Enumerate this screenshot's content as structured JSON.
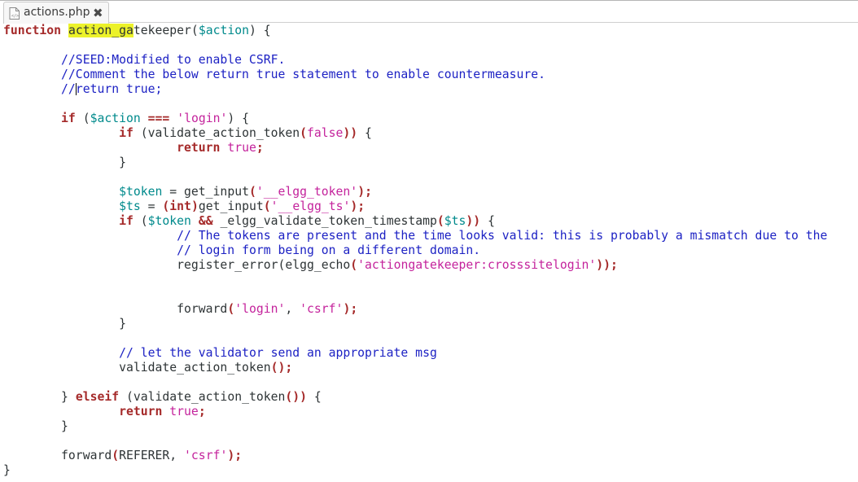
{
  "tab": {
    "filename": "actions.php",
    "file_icon": "document-icon",
    "close_icon": "close-x-icon"
  },
  "search": {
    "highlight": "action_ga"
  },
  "code": {
    "l1_kw": "function",
    "l1_hl": "action_ga",
    "l1_rest": "tekeeper(",
    "l1_var": "$action",
    "l1_end": ") {",
    "l3": "//SEED:Modified to enable CSRF.",
    "l4": "//Comment the below return true statement to enable countermeasure.",
    "l5_a": "//",
    "l5_b": "return true;",
    "l7_kw": "if",
    "l7_a": " (",
    "l7_var": "$action",
    "l7_b": " ",
    "l7_op": "===",
    "l7_c": " ",
    "l7_str": "'login'",
    "l7_d": ") {",
    "l8_kw": "if",
    "l8_a": " (validate_action_token",
    "l8_p1": "(",
    "l8_false": "false",
    "l8_p2": "))",
    "l8_b": " {",
    "l9_kw": "return",
    "l9_sp": " ",
    "l9_true": "true",
    "l9_semi": ";",
    "l10": "}",
    "l12_var": "$token",
    "l12_a": " = get_input",
    "l12_p1": "(",
    "l12_str": "'__elgg_token'",
    "l12_p2": ");",
    "l13_var": "$ts",
    "l13_a": " = ",
    "l13_p1": "(",
    "l13_int": "int",
    "l13_p2": ")",
    "l13_b": "get_input",
    "l13_p3": "(",
    "l13_str": "'__elgg_ts'",
    "l13_p4": ");",
    "l14_kw": "if",
    "l14_a": " (",
    "l14_var1": "$token",
    "l14_b": " ",
    "l14_op": "&&",
    "l14_c": " _elgg_validate_token_timestamp",
    "l14_p1": "(",
    "l14_var2": "$ts",
    "l14_p2": "))",
    "l14_d": " {",
    "l15": "// The tokens are present and the time looks valid: this is probably a mismatch due to the",
    "l16": "// login form being on a different domain.",
    "l17_a": "register_error(elgg_echo",
    "l17_p1": "(",
    "l17_str": "'actiongatekeeper:crosssitelogin'",
    "l17_p2": "));",
    "l20_a": "forward",
    "l20_p1": "(",
    "l20_str1": "'login'",
    "l20_b": ", ",
    "l20_str2": "'csrf'",
    "l20_p2": ");",
    "l21": "}",
    "l23": "// let the validator send an appropriate msg",
    "l24_a": "validate_action_token",
    "l24_p": "();",
    "l26_a": "} ",
    "l26_kw": "elseif",
    "l26_b": " (validate_action_token",
    "l26_p": "())",
    "l26_c": " {",
    "l27_kw": "return",
    "l27_sp": " ",
    "l27_true": "true",
    "l27_semi": ";",
    "l28": "}",
    "l30_a": "forward",
    "l30_p1": "(",
    "l30_b": "REFERER, ",
    "l30_str": "'csrf'",
    "l30_p2": ");",
    "l31": "}"
  },
  "colors": {
    "keyword": "#a52a2a",
    "variable": "#008a8c",
    "string": "#c4239c",
    "comment": "#1d22c4",
    "search_highlight": "#ecf22a"
  }
}
